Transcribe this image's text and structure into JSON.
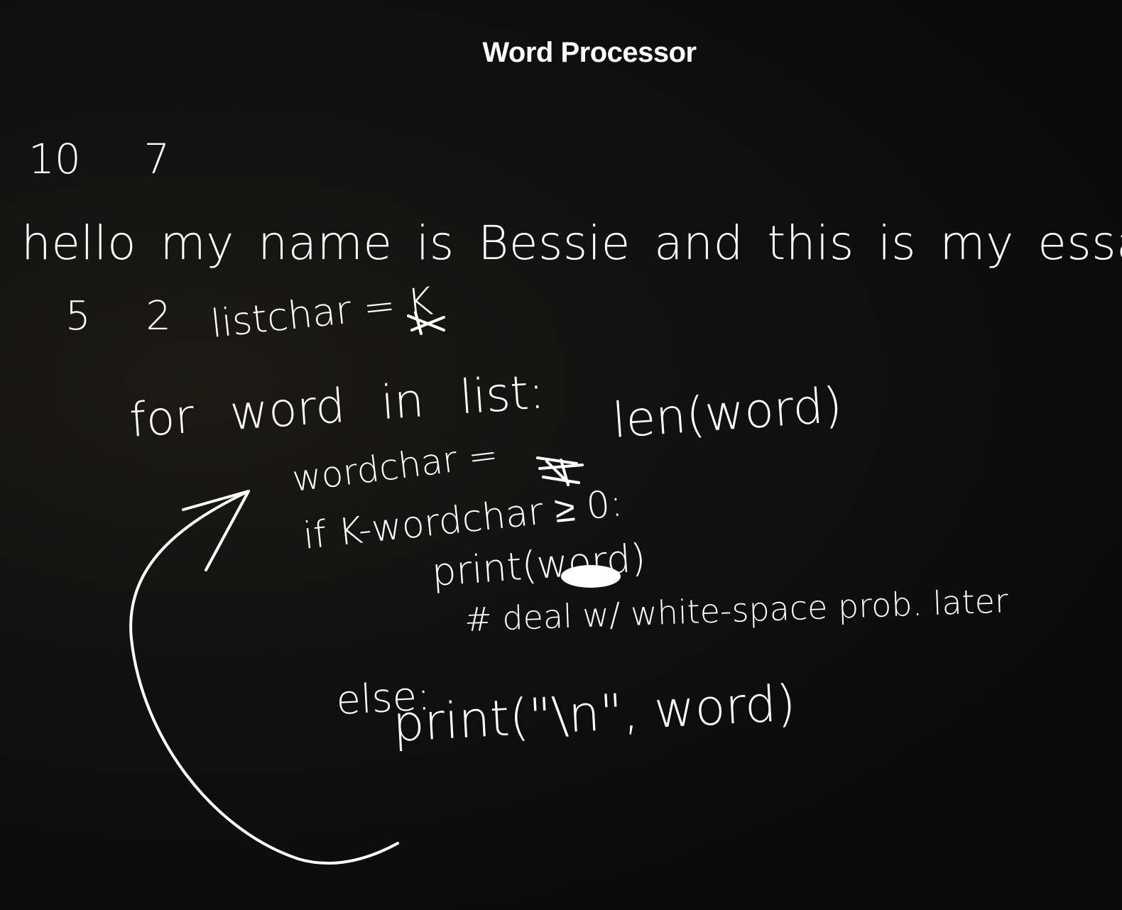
{
  "app": {
    "title": "Word Processor"
  },
  "notes": {
    "line_input_counts": "10   7",
    "line_essay": "hello my name is Bessie and this is my essay",
    "line_sample_counts": "5 2",
    "line_listchar": "listchar = K",
    "line_for": "for word in list:",
    "line_len": "len(word)",
    "line_wordchar": "wordchar =",
    "line_if": "if K-wordchar ≥ 0:",
    "line_print_word": "print(word)",
    "line_comment": "# deal w/ white-space prob. later",
    "line_else": "else:",
    "line_print_newline": "print(\"\\n\", word)"
  },
  "colors": {
    "background": "#0e0e0e",
    "ink": "#ffffff"
  },
  "icons": {
    "loop_arrow": "curved-arrow-icon",
    "scribble": "scribble-out-icon"
  }
}
